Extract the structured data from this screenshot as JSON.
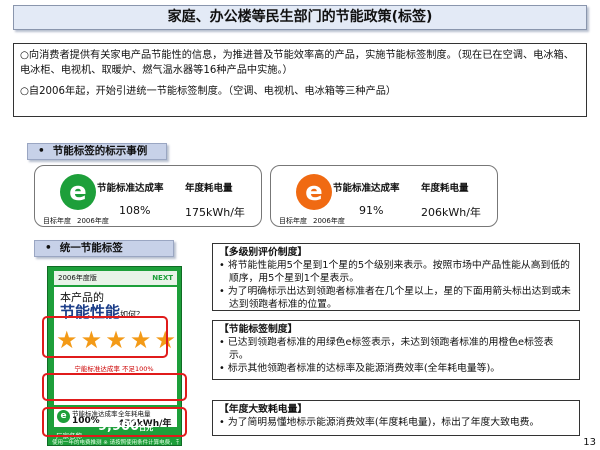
{
  "title": "家庭、办公楼等民生部门的节能政策(标签)",
  "intro": [
    "○向消费者提供有关家电产品节能性的信息，为推进普及节能效率高的产品，实施节能标签制度。（现在已在空调、电冰箱、电冰柜、电视机、取暖炉、燃气温水器等16种产品中实施。）",
    "○自2006年起，开始引进统一节能标签制度。（空调、电视机、电冰箱等三种产品）"
  ],
  "section1": {
    "bullet": "•",
    "label": "节能标签的标示事例"
  },
  "example_green": {
    "logo_char": "e",
    "logo_color": "#1d9f3a",
    "caption_left": "目标年度",
    "caption_right": "2006年度",
    "col1_head": "节能标准达成率",
    "col2_head": "年度耗电量",
    "col1_val": "108%",
    "col2_val": "175kWh/年"
  },
  "example_orange": {
    "logo_char": "e",
    "logo_color": "#f06a12",
    "caption_left": "目标年度",
    "caption_right": "2006年度",
    "col1_head": "节能标准达成率",
    "col2_head": "年度耗电量",
    "col1_val": "91%",
    "col2_val": "206kWh/年"
  },
  "section2": {
    "bullet": "•",
    "label": "统一节能标签"
  },
  "label_image": {
    "year": "2006年度版",
    "brand": "NEXT",
    "line1": "本产品的",
    "line2": "节能性能",
    "line2_suffix": "如何？",
    "star_glyph": "★",
    "stars": 5,
    "note": "宁能标准达成率 不足100%",
    "mid_head1": "节能标准达成率",
    "mid_head2": "全年耗电量",
    "mid_val1": "100%",
    "mid_val2": "450kWh/年",
    "mini_logo": "e",
    "bottom_label": "厂家名称",
    "cost_value": "9,900",
    "cost_unit": "日元",
    "footer": "使用一年的电费推测  ※ 请按照使用条件计算电费，节能性能的表示"
  },
  "box1": {
    "title": "【多级别评价制度】",
    "items": [
      "将节能性能用5个星到1个星的5个级别来表示。按照市场中产品性能从高到低的顺序，用5个星到1个星表示。",
      "为了明确标示出达到领跑者标准者在几个星以上，星的下面用箭头标出达到或未达到领跑者标准的位置。"
    ]
  },
  "box2": {
    "title": "【节能标签制度】",
    "items": [
      "已达到领跑者标准的用绿色e标签表示，未达到领跑者标准的用橙色e标签表示。",
      "标示其他领跑者标准的达标率及能源消费效率(全年耗电量等)。"
    ]
  },
  "box3": {
    "title": "【年度大致耗电量】",
    "items": [
      "为了简明易懂地标示能源消费效率(年度耗电量)，标出了年度大致电费。"
    ]
  },
  "page_number": "13"
}
